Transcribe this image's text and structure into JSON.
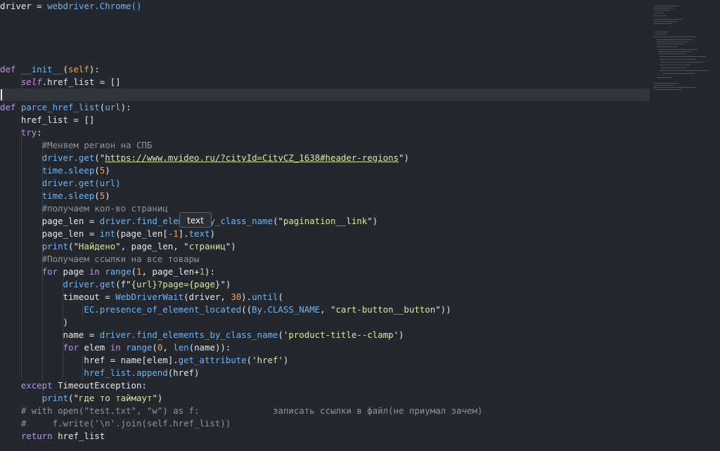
{
  "editor": {
    "lines": [
      {
        "segments": [
          {
            "t": "driver = ",
            "c": "op"
          },
          {
            "t": "webdriver.Chrome()",
            "c": "fn"
          }
        ]
      },
      {
        "segments": []
      },
      {
        "segments": []
      },
      {
        "segments": []
      },
      {
        "segments": []
      },
      {
        "segments": [
          {
            "t": "def ",
            "c": "kw"
          },
          {
            "t": "__init__",
            "c": "fn"
          },
          {
            "t": "(",
            "c": "op"
          },
          {
            "t": "self",
            "c": "num"
          },
          {
            "t": "):",
            "c": "op"
          }
        ]
      },
      {
        "segments": [
          {
            "t": "    ",
            "c": "op"
          },
          {
            "t": "self",
            "c": "sf"
          },
          {
            "t": ".href_list = []",
            "c": "op"
          }
        ]
      },
      {
        "segments": []
      },
      {
        "segments": [
          {
            "t": "def ",
            "c": "kw"
          },
          {
            "t": "parce_href_list",
            "c": "fn"
          },
          {
            "t": "(",
            "c": "op"
          },
          {
            "t": "url",
            "c": "fn"
          },
          {
            "t": "):",
            "c": "op"
          }
        ]
      },
      {
        "segments": [
          {
            "t": "    href_list = []",
            "c": "op"
          }
        ]
      },
      {
        "segments": [
          {
            "t": "    ",
            "c": "op"
          },
          {
            "t": "try",
            "c": "kw"
          },
          {
            "t": ":",
            "c": "op"
          }
        ]
      },
      {
        "segments": [
          {
            "t": "        #Меняем регион на СПБ",
            "c": "cm"
          }
        ]
      },
      {
        "segments": [
          {
            "t": "        ",
            "c": "op"
          },
          {
            "t": "driver.get",
            "c": "fn"
          },
          {
            "t": "(\"",
            "c": "op"
          },
          {
            "t": "https://www.mvideo.ru/?cityId=CityCZ_1638#header-regions",
            "c": "url"
          },
          {
            "t": "\")",
            "c": "op"
          }
        ]
      },
      {
        "segments": [
          {
            "t": "        ",
            "c": "op"
          },
          {
            "t": "time.sleep",
            "c": "fn"
          },
          {
            "t": "(",
            "c": "op"
          },
          {
            "t": "5",
            "c": "num"
          },
          {
            "t": ")",
            "c": "op"
          }
        ]
      },
      {
        "segments": [
          {
            "t": "        ",
            "c": "op"
          },
          {
            "t": "driver.get",
            "c": "fn"
          },
          {
            "t": "(url)",
            "c": "fn"
          }
        ]
      },
      {
        "segments": [
          {
            "t": "        ",
            "c": "op"
          },
          {
            "t": "time.sleep",
            "c": "fn"
          },
          {
            "t": "(",
            "c": "op"
          },
          {
            "t": "5",
            "c": "num"
          },
          {
            "t": ")",
            "c": "op"
          }
        ]
      },
      {
        "segments": [
          {
            "t": "        #получаем кол-во страниц",
            "c": "cm"
          }
        ]
      },
      {
        "segments": [
          {
            "t": "        page_len = ",
            "c": "op"
          },
          {
            "t": "driver.find_elem",
            "c": "fn"
          },
          {
            "t": "     ",
            "c": "op"
          },
          {
            "t": "y_class_name",
            "c": "fn"
          },
          {
            "t": "(\"",
            "c": "op"
          },
          {
            "t": "pagination__link",
            "c": "str"
          },
          {
            "t": "\")",
            "c": "op"
          }
        ]
      },
      {
        "segments": [
          {
            "t": "        page_len = ",
            "c": "op"
          },
          {
            "t": "int",
            "c": "fn"
          },
          {
            "t": "(page_len[",
            "c": "op"
          },
          {
            "t": "-1",
            "c": "num"
          },
          {
            "t": "].",
            "c": "op"
          },
          {
            "t": "text",
            "c": "fn"
          },
          {
            "t": ")",
            "c": "op"
          }
        ]
      },
      {
        "segments": [
          {
            "t": "        ",
            "c": "op"
          },
          {
            "t": "print",
            "c": "fn"
          },
          {
            "t": "(\"",
            "c": "op"
          },
          {
            "t": "Найдено",
            "c": "str"
          },
          {
            "t": "\", page_len, \"",
            "c": "op"
          },
          {
            "t": "страниц",
            "c": "str"
          },
          {
            "t": "\")",
            "c": "op"
          }
        ]
      },
      {
        "segments": [
          {
            "t": "        #Получаем ссылки на все товары",
            "c": "cm"
          }
        ]
      },
      {
        "segments": [
          {
            "t": "        ",
            "c": "op"
          },
          {
            "t": "for",
            "c": "kw"
          },
          {
            "t": " page ",
            "c": "op"
          },
          {
            "t": "in",
            "c": "kw"
          },
          {
            "t": " ",
            "c": "op"
          },
          {
            "t": "range",
            "c": "fn"
          },
          {
            "t": "(",
            "c": "op"
          },
          {
            "t": "1",
            "c": "num"
          },
          {
            "t": ", page_len+",
            "c": "op"
          },
          {
            "t": "1",
            "c": "num"
          },
          {
            "t": "):",
            "c": "op"
          }
        ]
      },
      {
        "segments": [
          {
            "t": "            ",
            "c": "op"
          },
          {
            "t": "driver.get",
            "c": "fn"
          },
          {
            "t": "(f\"",
            "c": "op"
          },
          {
            "t": "{url}?page={page}",
            "c": "str"
          },
          {
            "t": "\")",
            "c": "op"
          }
        ]
      },
      {
        "segments": [
          {
            "t": "            timeout = ",
            "c": "op"
          },
          {
            "t": "WebDriverWait",
            "c": "fn"
          },
          {
            "t": "(driver, ",
            "c": "op"
          },
          {
            "t": "30",
            "c": "num"
          },
          {
            "t": ").",
            "c": "op"
          },
          {
            "t": "until",
            "c": "fn"
          },
          {
            "t": "(",
            "c": "op"
          }
        ]
      },
      {
        "segments": [
          {
            "t": "                ",
            "c": "op"
          },
          {
            "t": "EC.presence_of_element_located",
            "c": "fn"
          },
          {
            "t": "((",
            "c": "op"
          },
          {
            "t": "By.CLASS_NAME",
            "c": "fn"
          },
          {
            "t": ", \"",
            "c": "op"
          },
          {
            "t": "cart-button__button",
            "c": "str"
          },
          {
            "t": "\"))",
            "c": "op"
          }
        ]
      },
      {
        "segments": [
          {
            "t": "            )",
            "c": "op"
          }
        ]
      },
      {
        "segments": [
          {
            "t": "            name = ",
            "c": "op"
          },
          {
            "t": "driver.find_elements_by_class_name",
            "c": "fn"
          },
          {
            "t": "('",
            "c": "op"
          },
          {
            "t": "product-title--clamp",
            "c": "str"
          },
          {
            "t": "')",
            "c": "op"
          }
        ]
      },
      {
        "segments": [
          {
            "t": "            ",
            "c": "op"
          },
          {
            "t": "for",
            "c": "kw"
          },
          {
            "t": " elem ",
            "c": "op"
          },
          {
            "t": "in",
            "c": "kw"
          },
          {
            "t": " ",
            "c": "op"
          },
          {
            "t": "range",
            "c": "fn"
          },
          {
            "t": "(",
            "c": "op"
          },
          {
            "t": "0",
            "c": "num"
          },
          {
            "t": ", ",
            "c": "op"
          },
          {
            "t": "len",
            "c": "fn"
          },
          {
            "t": "(name)):",
            "c": "op"
          }
        ]
      },
      {
        "segments": [
          {
            "t": "                href = name[elem].",
            "c": "op"
          },
          {
            "t": "get_attribute",
            "c": "fn"
          },
          {
            "t": "('",
            "c": "op"
          },
          {
            "t": "href",
            "c": "str"
          },
          {
            "t": "')",
            "c": "op"
          }
        ]
      },
      {
        "segments": [
          {
            "t": "                ",
            "c": "op"
          },
          {
            "t": "href_list.append",
            "c": "fn"
          },
          {
            "t": "(href)",
            "c": "op"
          }
        ]
      },
      {
        "segments": [
          {
            "t": "    ",
            "c": "op"
          },
          {
            "t": "except",
            "c": "kw"
          },
          {
            "t": " TimeoutException:",
            "c": "op"
          }
        ]
      },
      {
        "segments": [
          {
            "t": "        ",
            "c": "op"
          },
          {
            "t": "print",
            "c": "fn"
          },
          {
            "t": "(\"",
            "c": "op"
          },
          {
            "t": "где то таймаут",
            "c": "str"
          },
          {
            "t": "\")",
            "c": "op"
          }
        ]
      },
      {
        "segments": [
          {
            "t": "    # with open(\"test.txt\", \"w\") as f:              записать ссылки в файл(не приумал зачем)",
            "c": "cm"
          }
        ]
      },
      {
        "segments": [
          {
            "t": "    #     f.write('\\n'.join(self.href_list))",
            "c": "cm"
          }
        ]
      },
      {
        "segments": [
          {
            "t": "    ",
            "c": "op"
          },
          {
            "t": "return",
            "c": "kw"
          },
          {
            "t": " href_list",
            "c": "op"
          }
        ]
      }
    ],
    "tooltip": "text",
    "colors": {
      "background": "#24272d",
      "active_line": "#31353d",
      "keyword": "#b794e6",
      "function": "#72b3f0",
      "string": "#dbe6a7",
      "number": "#f3a161",
      "comment": "#8f949d"
    }
  }
}
